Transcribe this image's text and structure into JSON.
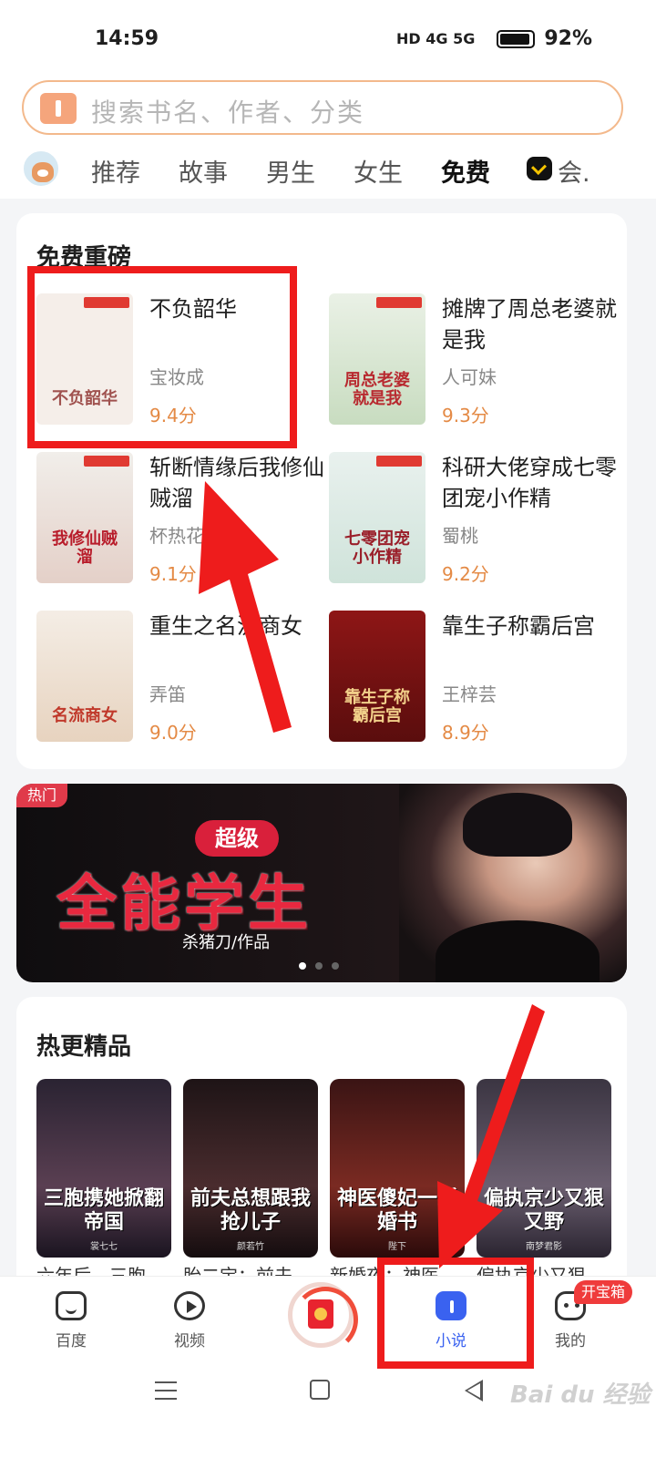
{
  "status_bar": {
    "time": "14:59",
    "network_labels": "HD 4G 5G",
    "battery": "92%"
  },
  "search": {
    "placeholder": "搜索书名、作者、分类"
  },
  "tabs": [
    {
      "label": "推荐"
    },
    {
      "label": "故事"
    },
    {
      "label": "男生"
    },
    {
      "label": "女生"
    },
    {
      "label": "免费",
      "active": true
    },
    {
      "label": "会."
    }
  ],
  "free_section": {
    "title": "免费重磅",
    "books": [
      {
        "title": "不负韶华",
        "author": "宝妆成",
        "score": "9.4分",
        "cover_text": "不负韶华",
        "cover_color": "#f5eee9"
      },
      {
        "title": "摊牌了周总老婆就是我",
        "author": "人可妹",
        "score": "9.3分",
        "cover_text": "周总老婆就是我",
        "cover_color": "#eaf1e6"
      },
      {
        "title": "斩断情缘后我修仙贼溜",
        "author": "杯热花",
        "score": "9.1分",
        "cover_text": "我修仙贼溜",
        "cover_color": "#f1eeea"
      },
      {
        "title": "科研大佬穿成七零团宠小作精",
        "author": "蜀桃",
        "score": "9.2分",
        "cover_text": "七零团宠小作精",
        "cover_color": "#e9f1ee"
      },
      {
        "title": "重生之名流商女",
        "author": "弄笛",
        "score": "9.0分",
        "cover_text": "名流商女",
        "cover_color": "#f4ede5"
      },
      {
        "title": "靠生子称霸后宫",
        "author": "王梓芸",
        "score": "8.9分",
        "cover_text": "靠生子称霸后宫",
        "cover_color": "#8e1616"
      }
    ]
  },
  "banner": {
    "tag": "热门",
    "super": "超级",
    "title": "全能学生",
    "author": "杀猪刀/作品"
  },
  "hot_section": {
    "title": "热更精品",
    "books": [
      {
        "cover_text": "三胞携她掀翻帝国",
        "cover_author": "裳七七",
        "cover_color": "#3a2a36",
        "label": "六年后，三胞"
      },
      {
        "cover_text": "前夫总想跟我抢儿子",
        "cover_author": "颜若竹",
        "cover_color": "#2a1b1e",
        "label": "胎二宝：前夫"
      },
      {
        "cover_text": "神医傻妃一纸婚书",
        "cover_author": "陛下",
        "cover_color": "#5a1e1e",
        "label": "新婚夜：神医"
      },
      {
        "cover_text": "偏执京少又狠又野",
        "cover_author": "南梦君影",
        "cover_color": "#4b4250",
        "label": "偏执京少又狠"
      }
    ]
  },
  "bottom_nav": [
    {
      "label": "百度"
    },
    {
      "label": "视频"
    },
    {
      "label": ""
    },
    {
      "label": "小说",
      "active": true
    },
    {
      "label": "我的"
    }
  ],
  "treasure_badge": "开宝箱",
  "watermark": "Bai du 经验"
}
